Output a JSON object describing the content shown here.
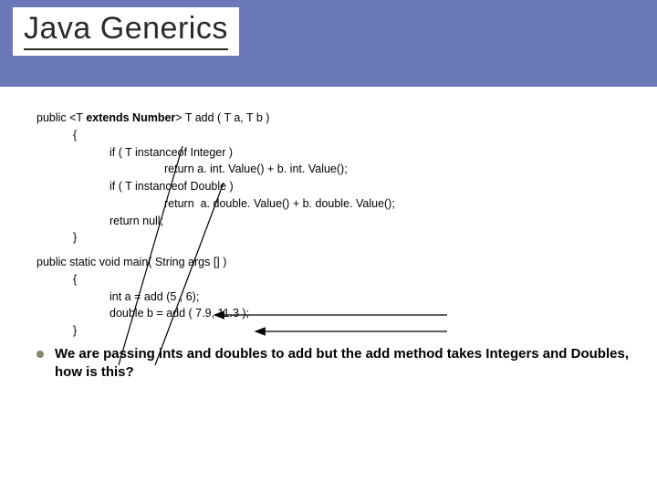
{
  "title": "Java Generics",
  "code": {
    "sig_prefix": "public <T ",
    "sig_bold": "extends Number",
    "sig_suffix": "> T add ( T a, T b )",
    "brace_open": "{",
    "if_int": "if ( T instanceof Integer )",
    "ret_int": "return a. int. Value() + b. int. Value();",
    "if_dbl": "if ( T instanceof Double )",
    "ret_dbl": "return  a. double. Value() + b. double. Value();",
    "ret_null": "return null;",
    "brace_close": "}",
    "main_sig": "public static void main( String args [] )",
    "main_open": "{",
    "main_a": "int a = add (5 , 6);",
    "main_b": "double b = add ( 7.9, 11.3 );",
    "main_close": "}"
  },
  "bullet": "We are passing ints and doubles to add but the add method takes Integers and Doubles, how is this?"
}
